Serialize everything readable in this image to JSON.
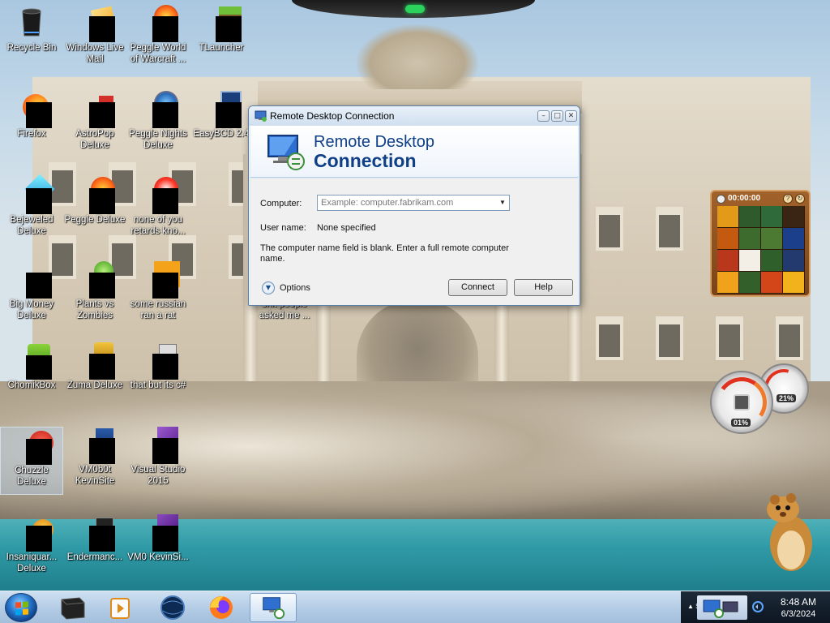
{
  "desktop": {
    "icons": [
      {
        "label": "Recycle Bin"
      },
      {
        "label": "Windows Live Mail"
      },
      {
        "label": "Peggle World of Warcraft ..."
      },
      {
        "label": "TLauncher"
      },
      {
        "label": "Firefox"
      },
      {
        "label": "AstroPop Deluxe"
      },
      {
        "label": "Peggle Nights Deluxe"
      },
      {
        "label": "EasyBCD 2.4"
      },
      {
        "label": "Bejeweled Deluxe"
      },
      {
        "label": "Peggle Deluxe"
      },
      {
        "label": "none of you retards kno..."
      },
      {
        "label": "Big Money Deluxe"
      },
      {
        "label": "Plants vs Zombies"
      },
      {
        "label": "some russian ran a rat"
      },
      {
        "label": "shit people asked me ..."
      },
      {
        "label": "ChomikBox"
      },
      {
        "label": "Zuma Deluxe"
      },
      {
        "label": "that but its c#"
      },
      {
        "label": "Chuzzle Deluxe"
      },
      {
        "label": "VM0b0t KevinSite"
      },
      {
        "label": "Visual Studio 2015"
      },
      {
        "label": "Insaniquar... Deluxe"
      },
      {
        "label": "Endermanc..."
      },
      {
        "label": "VM0 KevinSi..."
      }
    ]
  },
  "rdc_window": {
    "title": "Remote Desktop Connection",
    "minimize": "–",
    "maximize": "□",
    "close": "✕",
    "banner_line1": "Remote Desktop",
    "banner_line2": "Connection",
    "computer_label": "Computer:",
    "computer_placeholder": "Example: computer.fabrikam.com",
    "dropdown_glyph": "▼",
    "username_label": "User name:",
    "username_value": "None specified",
    "message": "The computer name field is blank. Enter a full remote computer name.",
    "options_glyph": "▼",
    "options_label": "Options",
    "connect_label": "Connect",
    "help_label": "Help"
  },
  "puzzle_gadget": {
    "timer": "00:00:00",
    "help_btn": "?",
    "reset_btn": "↻",
    "tiles": [
      "#e39a18",
      "#2f5a2b",
      "#2e6a3a",
      "#3a2414",
      "#c45a10",
      "#3d6b2e",
      "#4c7a32",
      "#1c3f8c",
      "#b9371a",
      "#f3efe6",
      "#2f5f2a",
      "#223a6d",
      "#f0a21a",
      "#335f2a",
      "#d2461a",
      "#f2b21b"
    ]
  },
  "meter_gadget": {
    "cpu_value": "01%",
    "memory_value": "21%"
  },
  "taskbar": {
    "tray_expand": "▲ S",
    "clock_time": "8:48 AM",
    "clock_date": "6/3/2024"
  },
  "colors": {
    "banner_text": "#0f3f86",
    "taskbar_top": "#cfe0f1",
    "tray_bg": "#0c1520"
  }
}
